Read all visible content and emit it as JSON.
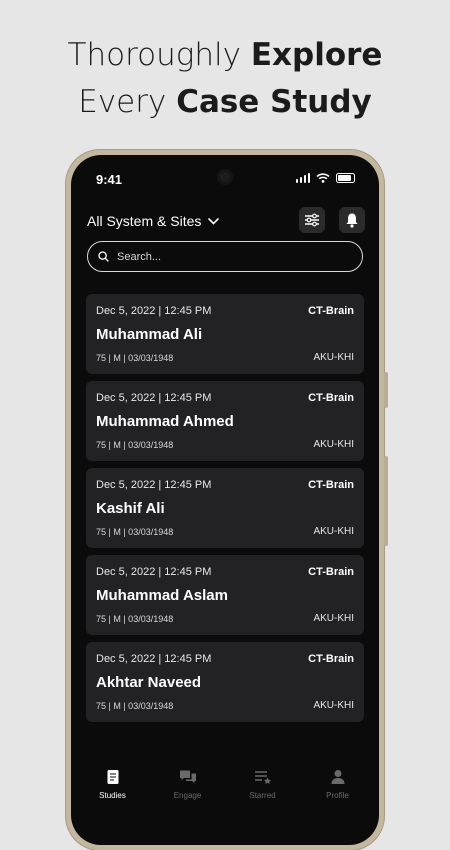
{
  "headline": {
    "line1_normal": "Thoroughly ",
    "line1_bold": "Explore",
    "line2_normal": "Every ",
    "line2_bold": "Case Study"
  },
  "status_bar": {
    "time": "9:41"
  },
  "header": {
    "site_filter_label": "All System & Sites",
    "filter_icon": "sliders-icon",
    "notification_icon": "bell-icon"
  },
  "search": {
    "placeholder": "Search...",
    "value": ""
  },
  "studies": [
    {
      "date": "Dec 5, 2022 | 12:45 PM",
      "modality": "CT-Brain",
      "name": "Muhammad Ali",
      "meta": "75 | M | 03/03/1948",
      "site": "AKU-KHI"
    },
    {
      "date": "Dec 5, 2022 | 12:45 PM",
      "modality": "CT-Brain",
      "name": "Muhammad Ahmed",
      "meta": "75 | M | 03/03/1948",
      "site": "AKU-KHI"
    },
    {
      "date": "Dec 5, 2022 | 12:45 PM",
      "modality": "CT-Brain",
      "name": "Kashif Ali",
      "meta": "75 | M | 03/03/1948",
      "site": "AKU-KHI"
    },
    {
      "date": "Dec 5, 2022 | 12:45 PM",
      "modality": "CT-Brain",
      "name": "Muhammad Aslam",
      "meta": "75 | M | 03/03/1948",
      "site": "AKU-KHI"
    },
    {
      "date": "Dec 5, 2022 | 12:45 PM",
      "modality": "CT-Brain",
      "name": "Akhtar Naveed",
      "meta": "75 | M | 03/03/1948",
      "site": "AKU-KHI"
    }
  ],
  "tabs": [
    {
      "label": "Studies",
      "icon": "document-icon",
      "active": true
    },
    {
      "label": "Engage",
      "icon": "chat-icon",
      "active": false
    },
    {
      "label": "Starred",
      "icon": "starred-list-icon",
      "active": false
    },
    {
      "label": "Profile",
      "icon": "person-icon",
      "active": false
    }
  ],
  "colors": {
    "background": "#e6e6e6",
    "screen": "#0b0b0b",
    "card": "#222224",
    "accent": "#ffffff",
    "inactive_tab": "#6a6a6a"
  }
}
